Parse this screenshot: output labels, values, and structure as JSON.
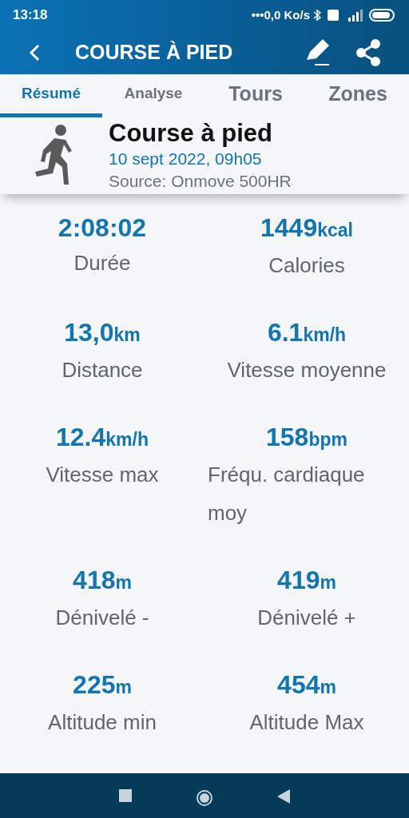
{
  "status_bar": {
    "time": "13:18",
    "network_speed": "•••0,0 Ko/s"
  },
  "app_bar": {
    "title": "COURSE À PIED"
  },
  "tabs": [
    {
      "label": "Résumé",
      "selected": true,
      "kind": "small"
    },
    {
      "label": "Analyse",
      "selected": false,
      "kind": "small"
    },
    {
      "label": "Tours",
      "selected": false,
      "kind": "large"
    },
    {
      "label": "Zones",
      "selected": false,
      "kind": "large"
    }
  ],
  "activity": {
    "name": "Course à pied",
    "date": "10 sept 2022, 09h05",
    "source": "Source: Onmove 500HR"
  },
  "stats": [
    {
      "value": "2:08:02",
      "label": "Durée"
    },
    {
      "value": "1449",
      "unit": "kcal",
      "label": "Calories"
    },
    {
      "value": "13,0",
      "unit": "km",
      "label": "Distance"
    },
    {
      "value": "6.1",
      "unit": "km/h",
      "label": "Vitesse moyenne"
    },
    {
      "value": "12.4",
      "unit": "km/h",
      "label": "Vitesse max"
    },
    {
      "value": "158",
      "unit": "bpm",
      "label": "Fréqu. cardiaque moy"
    },
    {
      "value": "418",
      "unit": "m",
      "label": "Dénivelé -"
    },
    {
      "value": "419",
      "unit": "m",
      "label": "Dénivelé +"
    },
    {
      "value": "225",
      "unit": "m",
      "label": "Altitude min"
    },
    {
      "value": "454",
      "unit": "m",
      "label": "Altitude Max"
    }
  ]
}
